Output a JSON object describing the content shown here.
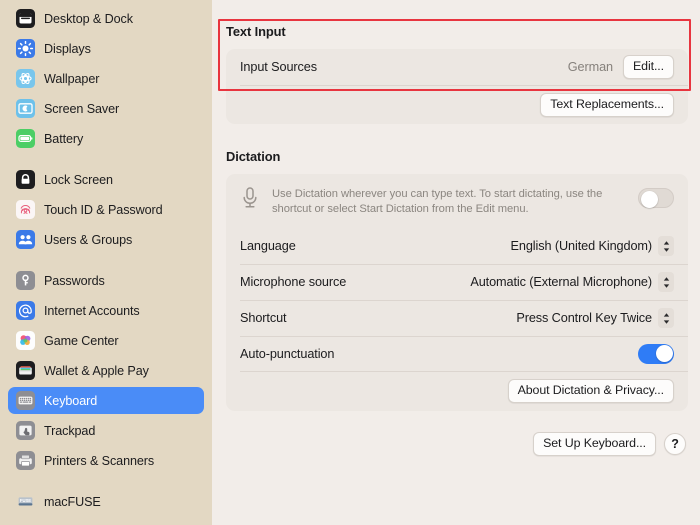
{
  "sidebar": {
    "groups": [
      {
        "items": [
          {
            "label": "Desktop & Dock",
            "icon": "desktop-dock-icon",
            "selected": false
          },
          {
            "label": "Displays",
            "icon": "displays-icon",
            "selected": false
          },
          {
            "label": "Wallpaper",
            "icon": "wallpaper-icon",
            "selected": false
          },
          {
            "label": "Screen Saver",
            "icon": "screen-saver-icon",
            "selected": false
          },
          {
            "label": "Battery",
            "icon": "battery-icon",
            "selected": false
          }
        ]
      },
      {
        "items": [
          {
            "label": "Lock Screen",
            "icon": "lock-screen-icon",
            "selected": false
          },
          {
            "label": "Touch ID & Password",
            "icon": "touch-id-icon",
            "selected": false
          },
          {
            "label": "Users & Groups",
            "icon": "users-groups-icon",
            "selected": false
          }
        ]
      },
      {
        "items": [
          {
            "label": "Passwords",
            "icon": "passwords-key-icon",
            "selected": false
          },
          {
            "label": "Internet Accounts",
            "icon": "internet-accounts-at-icon",
            "selected": false
          },
          {
            "label": "Game Center",
            "icon": "game-center-icon",
            "selected": false
          },
          {
            "label": "Wallet & Apple Pay",
            "icon": "wallet-apple-pay-icon",
            "selected": false
          },
          {
            "label": "Keyboard",
            "icon": "keyboard-icon",
            "selected": true
          },
          {
            "label": "Trackpad",
            "icon": "trackpad-icon",
            "selected": false
          },
          {
            "label": "Printers & Scanners",
            "icon": "printers-scanners-icon",
            "selected": false
          }
        ]
      },
      {
        "items": [
          {
            "label": "macFUSE",
            "icon": "macfuse-icon",
            "selected": false
          }
        ]
      }
    ]
  },
  "main": {
    "text_input": {
      "title": "Text Input",
      "input_sources_label": "Input Sources",
      "input_sources_value": "German",
      "edit_button": "Edit...",
      "text_replacements_button": "Text Replacements..."
    },
    "dictation": {
      "title": "Dictation",
      "description": "Use Dictation wherever you can type text. To start dictating, use the shortcut or select Start Dictation from the Edit menu.",
      "enabled": false,
      "language_label": "Language",
      "language_value": "English (United Kingdom)",
      "microphone_label": "Microphone source",
      "microphone_value": "Automatic (External Microphone)",
      "shortcut_label": "Shortcut",
      "shortcut_value": "Press Control Key Twice",
      "auto_punctuation_label": "Auto-punctuation",
      "auto_punctuation_on": true,
      "about_button": "About Dictation & Privacy..."
    },
    "footer": {
      "set_up_keyboard_button": "Set Up Keyboard...",
      "help_button": "?"
    }
  },
  "colors": {
    "sidebar_bg": "#e3d8c3",
    "panel_bg": "#f2ede9",
    "card_bg": "#ece7e2",
    "selection_blue": "#4a8cf7",
    "toggle_on_blue": "#2f7cf6",
    "highlight_red": "#e8353f"
  }
}
